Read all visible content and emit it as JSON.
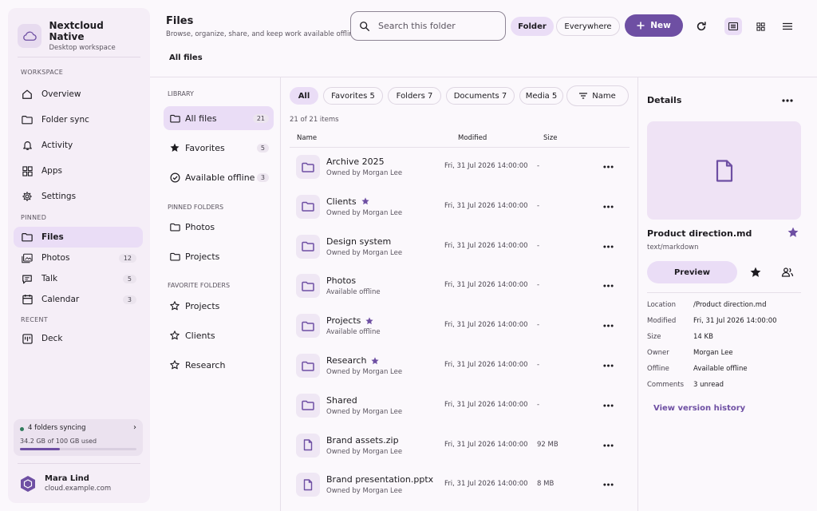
{
  "app": {
    "title": "Nextcloud Native",
    "subtitle": "Desktop workspace"
  },
  "colors": {
    "accent": "#6e4fa3",
    "selected": "#eaddf6",
    "sync_ok": "#2f7a5c"
  },
  "sidebar": {
    "workspace_label": "WORKSPACE",
    "workspace": [
      {
        "label": "Overview",
        "icon": "home-icon"
      },
      {
        "label": "Folder sync",
        "icon": "folder-sync-icon"
      },
      {
        "label": "Activity",
        "icon": "bell-icon"
      },
      {
        "label": "Apps",
        "icon": "apps-grid-icon"
      },
      {
        "label": "Settings",
        "icon": "gear-icon"
      }
    ],
    "pinned_label": "PINNED",
    "pinned": [
      {
        "label": "Files",
        "icon": "folder-icon",
        "badge": "",
        "active": true
      },
      {
        "label": "Photos",
        "icon": "photos-icon",
        "badge": "12"
      },
      {
        "label": "Talk",
        "icon": "chat-icon",
        "badge": "5"
      },
      {
        "label": "Calendar",
        "icon": "calendar-icon",
        "badge": "3"
      }
    ],
    "recent_label": "RECENT",
    "recent": [
      {
        "label": "Deck",
        "icon": "deck-icon"
      }
    ],
    "sync": {
      "title": "4 folders syncing",
      "usage": "34.2 GB of 100 GB used",
      "used_fraction": 0.342
    },
    "user": {
      "name": "Mara Lind",
      "server": "cloud.example.com"
    }
  },
  "header": {
    "title": "Files",
    "subtitle": "Browse, organize, share, and keep work available offline",
    "search_placeholder": "Search this folder",
    "scope_folder": "Folder",
    "scope_everywhere": "Everywhere",
    "new_label": "New",
    "breadcrumb": "All files"
  },
  "library": {
    "section": "LIBRARY",
    "items": [
      {
        "label": "All files",
        "count": "21",
        "icon": "folder-icon",
        "active": true
      },
      {
        "label": "Favorites",
        "count": "5",
        "icon": "star-icon"
      },
      {
        "label": "Available offline",
        "count": "3",
        "icon": "check-circle-icon"
      }
    ],
    "pinned_section": "PINNED FOLDERS",
    "pinned": [
      {
        "label": "Photos"
      },
      {
        "label": "Projects"
      }
    ],
    "favorite_section": "FAVORITE FOLDERS",
    "favorites": [
      {
        "label": "Projects"
      },
      {
        "label": "Clients"
      },
      {
        "label": "Research"
      }
    ]
  },
  "files": {
    "filters": [
      {
        "label": "All",
        "active": true
      },
      {
        "label": "Favorites 5"
      },
      {
        "label": "Folders 7"
      },
      {
        "label": "Documents 7"
      },
      {
        "label": "Media 5"
      }
    ],
    "sort_label": "Name",
    "count_label": "21 of 21 items",
    "columns": {
      "name": "Name",
      "modified": "Modified",
      "size": "Size"
    },
    "rows": [
      {
        "name": "Archive 2025",
        "sub": "Owned by Morgan Lee",
        "modified": "Fri, 31 Jul 2026 14:00:00",
        "size": "-",
        "kind": "folder",
        "starred": false
      },
      {
        "name": "Clients",
        "sub": "Owned by Morgan Lee",
        "modified": "Fri, 31 Jul 2026 14:00:00",
        "size": "-",
        "kind": "folder",
        "starred": true
      },
      {
        "name": "Design system",
        "sub": "Owned by Morgan Lee",
        "modified": "Fri, 31 Jul 2026 14:00:00",
        "size": "-",
        "kind": "folder",
        "starred": false
      },
      {
        "name": "Photos",
        "sub": "Available offline",
        "modified": "Fri, 31 Jul 2026 14:00:00",
        "size": "-",
        "kind": "folder",
        "starred": false
      },
      {
        "name": "Projects",
        "sub": "Available offline",
        "modified": "Fri, 31 Jul 2026 14:00:00",
        "size": "-",
        "kind": "folder",
        "starred": true
      },
      {
        "name": "Research",
        "sub": "Owned by Morgan Lee",
        "modified": "Fri, 31 Jul 2026 14:00:00",
        "size": "-",
        "kind": "folder",
        "starred": true
      },
      {
        "name": "Shared",
        "sub": "Owned by Morgan Lee",
        "modified": "Fri, 31 Jul 2026 14:00:00",
        "size": "-",
        "kind": "folder",
        "starred": false
      },
      {
        "name": "Brand assets.zip",
        "sub": "Owned by Morgan Lee",
        "modified": "Fri, 31 Jul 2026 14:00:00",
        "size": "92 MB",
        "kind": "file",
        "starred": false
      },
      {
        "name": "Brand presentation.pptx",
        "sub": "Owned by Morgan Lee",
        "modified": "Fri, 31 Jul 2026 14:00:00",
        "size": "8 MB",
        "kind": "file",
        "starred": false
      }
    ]
  },
  "details": {
    "title": "Details",
    "file_name": "Product direction.md",
    "mime": "text/markdown",
    "preview_label": "Preview",
    "meta": [
      {
        "key": "Location",
        "value": "/Product direction.md"
      },
      {
        "key": "Modified",
        "value": "Fri, 31 Jul 2026 14:00:00"
      },
      {
        "key": "Size",
        "value": "14 KB"
      },
      {
        "key": "Owner",
        "value": "Morgan Lee"
      },
      {
        "key": "Offline",
        "value": "Available offline"
      },
      {
        "key": "Comments",
        "value": "3 unread"
      }
    ],
    "version_link": "View version history"
  }
}
